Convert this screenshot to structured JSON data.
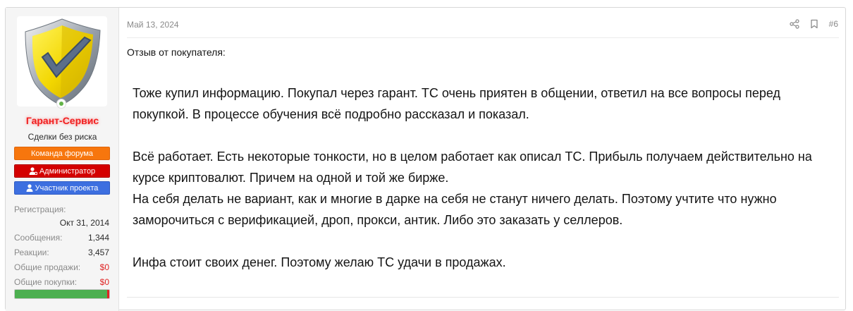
{
  "post": {
    "date": "Май 13, 2024",
    "number": "#6",
    "intro": "Отзыв от покупателя:",
    "paragraphs": [
      "Тоже купил информацию. Покупал через гарант. ТС очень приятен в общении, ответил на все вопросы перед покупкой. В процессе обучения всё подробно рассказал и показал.",
      "Всё работает. Есть некоторые тонкости, но в целом работает как описал ТС. Прибыль получаем действительно на курсе криптовалют. Причем на одной и той же бирже.",
      "На себя делать не вариант, как и многие в дарке на себя не станут ничего делать. Поэтому учтите что нужно заморочиться с верификацией, дроп, прокси, антик. Либо это заказать у селлеров.",
      "Инфа стоит своих денег. Поэтому желаю ТС удачи в продажах."
    ]
  },
  "user": {
    "name": "Гарант-Сервис",
    "title": "Сделки без риска",
    "banners": [
      "Команда форума",
      "Администратор",
      "Участник проекта"
    ],
    "stats": {
      "registration_label": "Регистрация:",
      "registration_value": "Окт 31, 2014",
      "messages_label": "Сообщения:",
      "messages_value": "1,344",
      "reactions_label": "Реакции:",
      "reactions_value": "3,457",
      "sales_label": "Общие продажи:",
      "sales_value": "$0",
      "purchases_label": "Общие покупки:",
      "purchases_value": "$0"
    },
    "progress": 0.98,
    "online": true
  },
  "icons": [
    "shield-avatar-icon",
    "user-admin-icon",
    "user-icon",
    "share-icon",
    "bookmark-icon"
  ],
  "colors": {
    "username": "#f12020",
    "banner_team": "#f7760d",
    "banner_admin": "#d40000",
    "banner_member": "#3d6fe0",
    "money": "#e02424",
    "progress": "#4caf50"
  }
}
